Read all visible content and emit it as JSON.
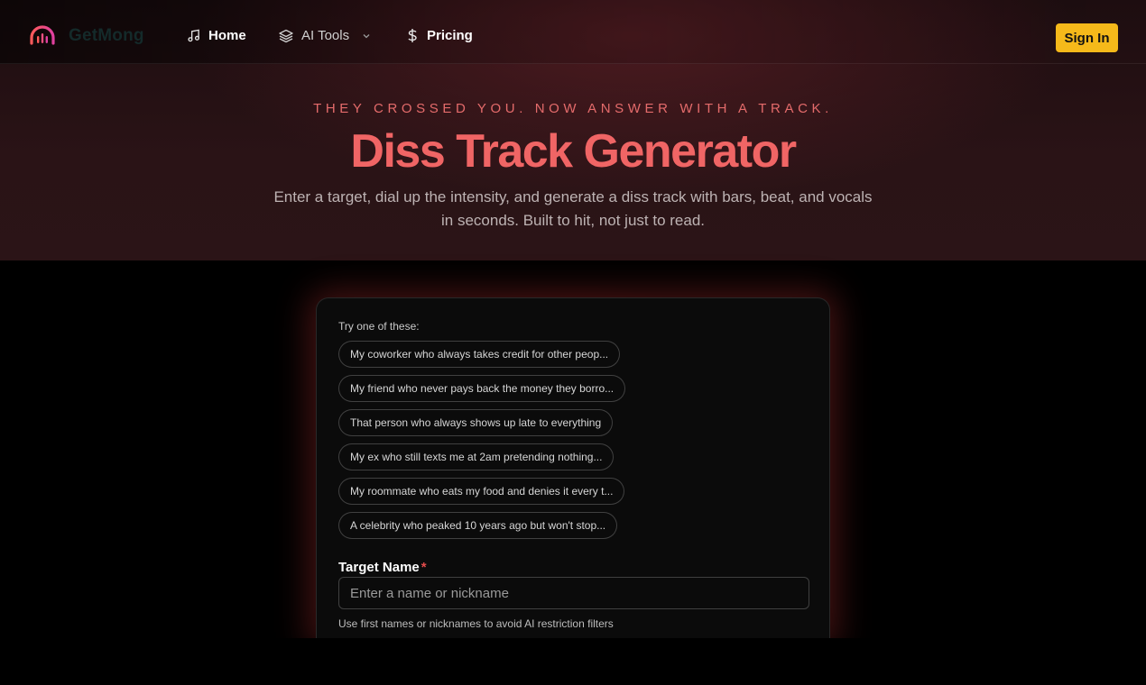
{
  "nav": {
    "brand": "GetMong",
    "items": [
      {
        "label": "Home",
        "icon": "music-note-icon"
      },
      {
        "label": "AI Tools",
        "icon": "layers-icon"
      },
      {
        "label": "Pricing",
        "icon": "dollar-icon"
      }
    ],
    "sign_in": "Sign In"
  },
  "hero": {
    "eyebrow": "THEY CROSSED YOU. NOW ANSWER WITH A TRACK.",
    "title": "Diss Track Generator",
    "subtitle": "Enter a target, dial up the intensity, and generate a diss track with bars, beat, and vocals in seconds. Built to hit, not just to read."
  },
  "form": {
    "try_label": "Try one of these:",
    "suggestions": [
      "My coworker who always takes credit for other peop...",
      "My friend who never pays back the money they borro...",
      "That person who always shows up late to everything",
      "My ex who still texts me at 2am pretending nothing...",
      "My roommate who eats my food and denies it every t...",
      "A celebrity who peaked 10 years ago but won't stop..."
    ],
    "target_label": "Target Name",
    "required_mark": "*",
    "target_placeholder": "Enter a name or nickname",
    "target_value": "",
    "hint": "Use first names or nicknames to avoid AI restriction filters"
  },
  "colors": {
    "accent": "#f06565",
    "button": "#f5b91a",
    "logo_gradient": [
      "#ff5a5a",
      "#e040a0"
    ]
  }
}
